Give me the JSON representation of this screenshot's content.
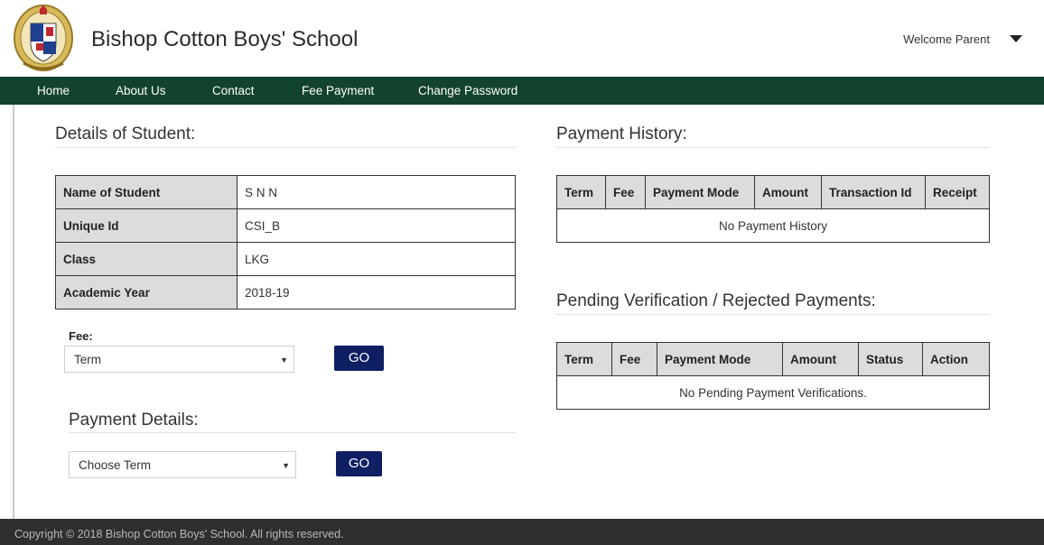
{
  "header": {
    "school_name": "Bishop Cotton Boys' School",
    "welcome": "Welcome Parent"
  },
  "nav": {
    "items": [
      "Home",
      "About Us",
      "Contact",
      "Fee Payment",
      "Change Password"
    ]
  },
  "student": {
    "title": "Details of Student:",
    "rows": [
      {
        "label": "Name of Student",
        "value": "S  N  N"
      },
      {
        "label": "Unique Id",
        "value": "CSI_B"
      },
      {
        "label": "Class",
        "value": "LKG"
      },
      {
        "label": "Academic Year",
        "value": "2018-19"
      }
    ]
  },
  "fee": {
    "label": "Fee:",
    "select_value": "Term",
    "go_label": "GO"
  },
  "payment_details": {
    "title": "Payment Details:",
    "select_value": "Choose Term",
    "go_label": "GO"
  },
  "payment_history": {
    "title": "Payment History:",
    "columns": [
      "Term",
      "Fee",
      "Payment Mode",
      "Amount",
      "Transaction Id",
      "Receipt"
    ],
    "empty_message": "No Payment History"
  },
  "pending": {
    "title": "Pending Verification / Rejected Payments:",
    "columns": [
      "Term",
      "Fee",
      "Payment Mode",
      "Amount",
      "Status",
      "Action"
    ],
    "empty_message": "No Pending Payment Verifications."
  },
  "footer": {
    "text": "Copyright © 2018 Bishop Cotton Boys' School. All rights reserved."
  },
  "colors": {
    "nav_bg": "#12432c",
    "button_bg": "#0f1f63",
    "footer_bg": "#2f2f2f"
  }
}
